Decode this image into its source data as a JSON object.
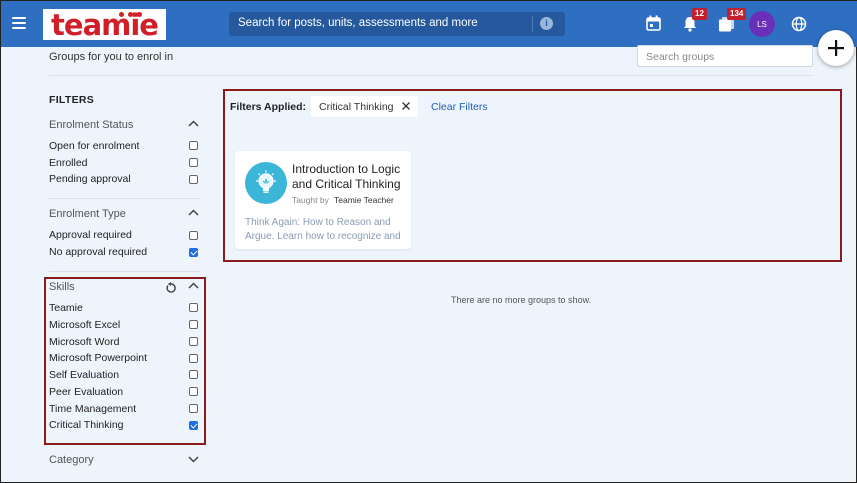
{
  "topbar": {
    "logo": "teamie",
    "search_placeholder": "Search for posts, units, assessments and more",
    "notifications_badge": "12",
    "posts_badge": "134",
    "avatar_initials": "LS"
  },
  "header": {
    "title": "Groups for you to enrol in",
    "search_groups_placeholder": "Search groups"
  },
  "filters": {
    "title": "FILTERS",
    "enrolment_status": {
      "label": "Enrolment Status",
      "options": [
        {
          "label": "Open for enrolment",
          "checked": false
        },
        {
          "label": "Enrolled",
          "checked": false
        },
        {
          "label": "Pending approval",
          "checked": false
        }
      ]
    },
    "enrolment_type": {
      "label": "Enrolment Type",
      "options": [
        {
          "label": "Approval required",
          "checked": false
        },
        {
          "label": "No approval required",
          "checked": true
        }
      ]
    },
    "skills": {
      "label": "Skills",
      "options": [
        {
          "label": "Teamie",
          "checked": false
        },
        {
          "label": "Microsoft Excel",
          "checked": false
        },
        {
          "label": "Microsoft Word",
          "checked": false
        },
        {
          "label": "Microsoft Powerpoint",
          "checked": false
        },
        {
          "label": "Self Evaluation",
          "checked": false
        },
        {
          "label": "Peer Evaluation",
          "checked": false
        },
        {
          "label": "Time Management",
          "checked": false
        },
        {
          "label": "Critical Thinking",
          "checked": true
        }
      ]
    },
    "category": {
      "label": "Category"
    }
  },
  "main": {
    "filters_applied_label": "Filters Applied:",
    "chip_label": "Critical Thinking",
    "clear_filters": "Clear Filters",
    "card": {
      "title": "Introduction to Logic and Critical Thinking",
      "taught_by": "Taught by",
      "teacher": "Teamie Teacher",
      "description": "Think Again: How to Reason and Argue. Learn how to recognize and"
    },
    "no_more": "There are no more groups to show."
  },
  "colors": {
    "topbar": "#2f6fc2",
    "accent_red": "#8b1a1a",
    "checkbox_checked": "#1f6fe0",
    "avatar": "#6a2fb8"
  },
  "icons": [
    "hamburger-menu-icon",
    "calendar-icon",
    "bell-icon",
    "posts-stack-icon",
    "globe-icon",
    "plus-icon",
    "chevron-up-icon",
    "chevron-down-icon",
    "reset-icon",
    "close-icon",
    "info-icon",
    "lightbulb-icon"
  ]
}
